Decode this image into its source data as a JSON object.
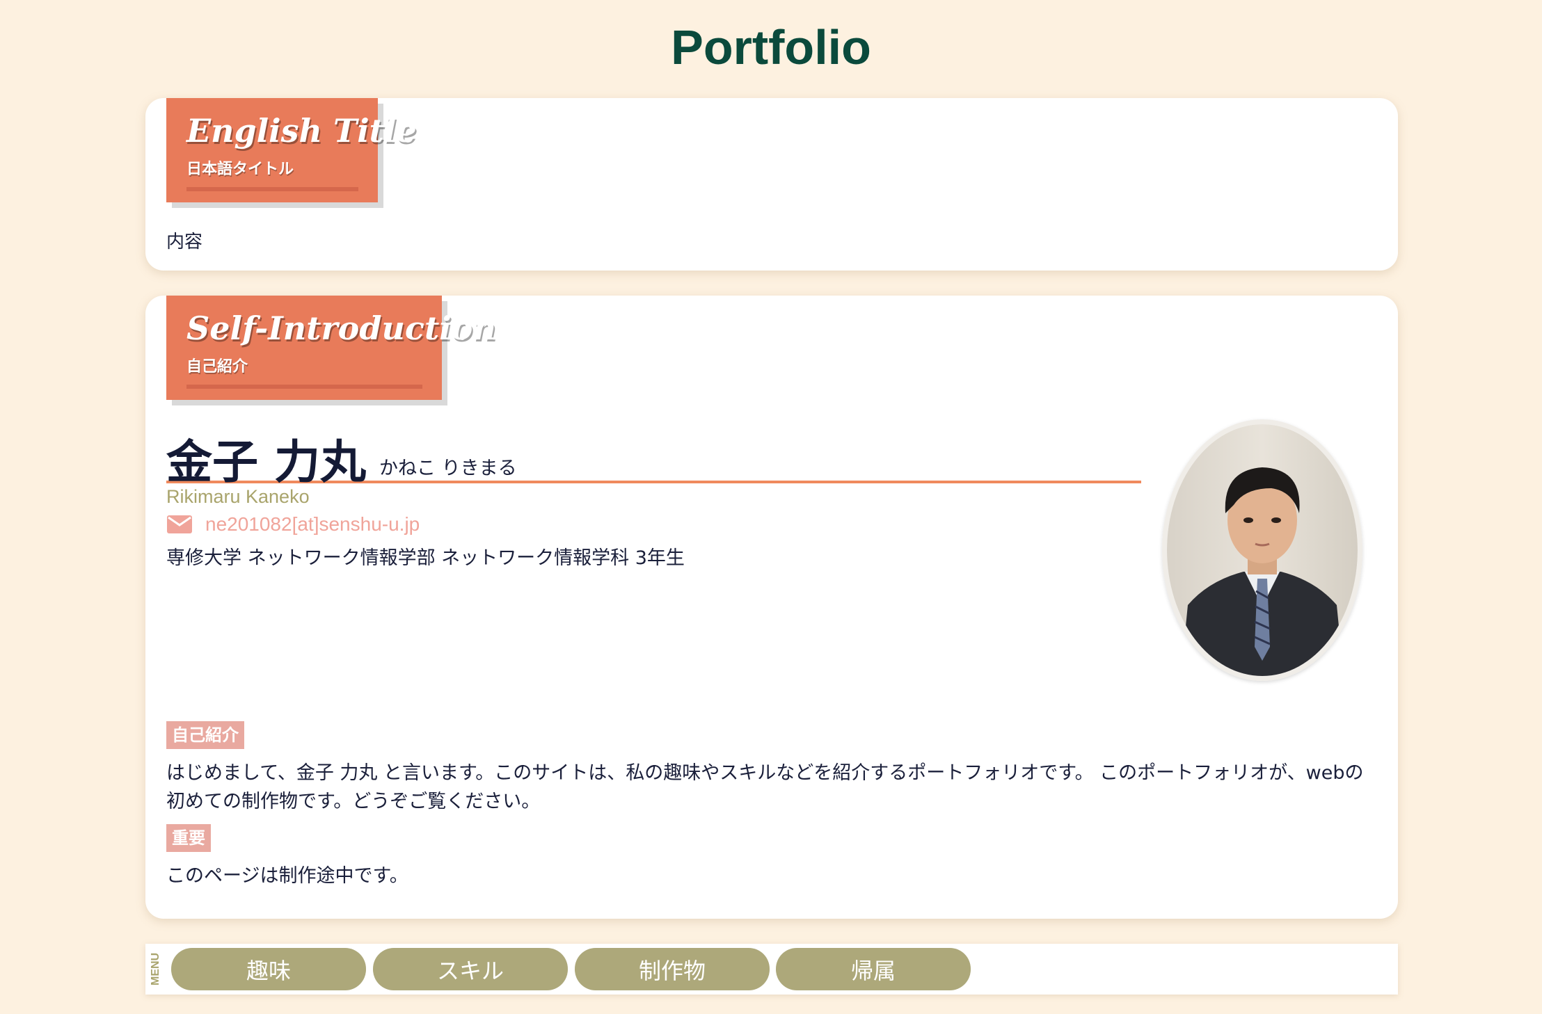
{
  "site": {
    "title": "Portfolio"
  },
  "sections": [
    {
      "title_en": "English Title",
      "title_ja": "日本語タイトル",
      "content": "内容"
    },
    {
      "title_en": "Self-Introduction",
      "title_ja": "自己紹介"
    }
  ],
  "profile": {
    "name_kanji": "金子 力丸",
    "name_kana": "かねこ りきまる",
    "name_roman": "Rikimaru Kaneko",
    "email": "ne201082[at]senshu-u.jp",
    "affiliation": "専修大学 ネットワーク情報学部 ネットワーク情報学科 3年生",
    "photo": "profile-photo"
  },
  "intro": {
    "tag": "自己紹介",
    "text": "はじめまして、金子 力丸 と言います。このサイトは、私の趣味やスキルなどを紹介するポートフォリオです。 このポートフォリオが、webの初めての制作物です。どうぞご覧ください。",
    "important_tag": "重要",
    "important_text": "このページは制作途中です。"
  },
  "menu": {
    "label": "MENU",
    "items": [
      "趣味",
      "スキル",
      "制作物",
      "帰属"
    ]
  },
  "colors": {
    "background": "#fdf1e0",
    "title": "#0b4a3c",
    "ribbon": "#e87b5a",
    "accent_line": "#f08a5d",
    "tag": "#e9a9a0",
    "menu_button": "#ada87a",
    "roman_name": "#a9a46c",
    "email": "#f0a49a"
  }
}
